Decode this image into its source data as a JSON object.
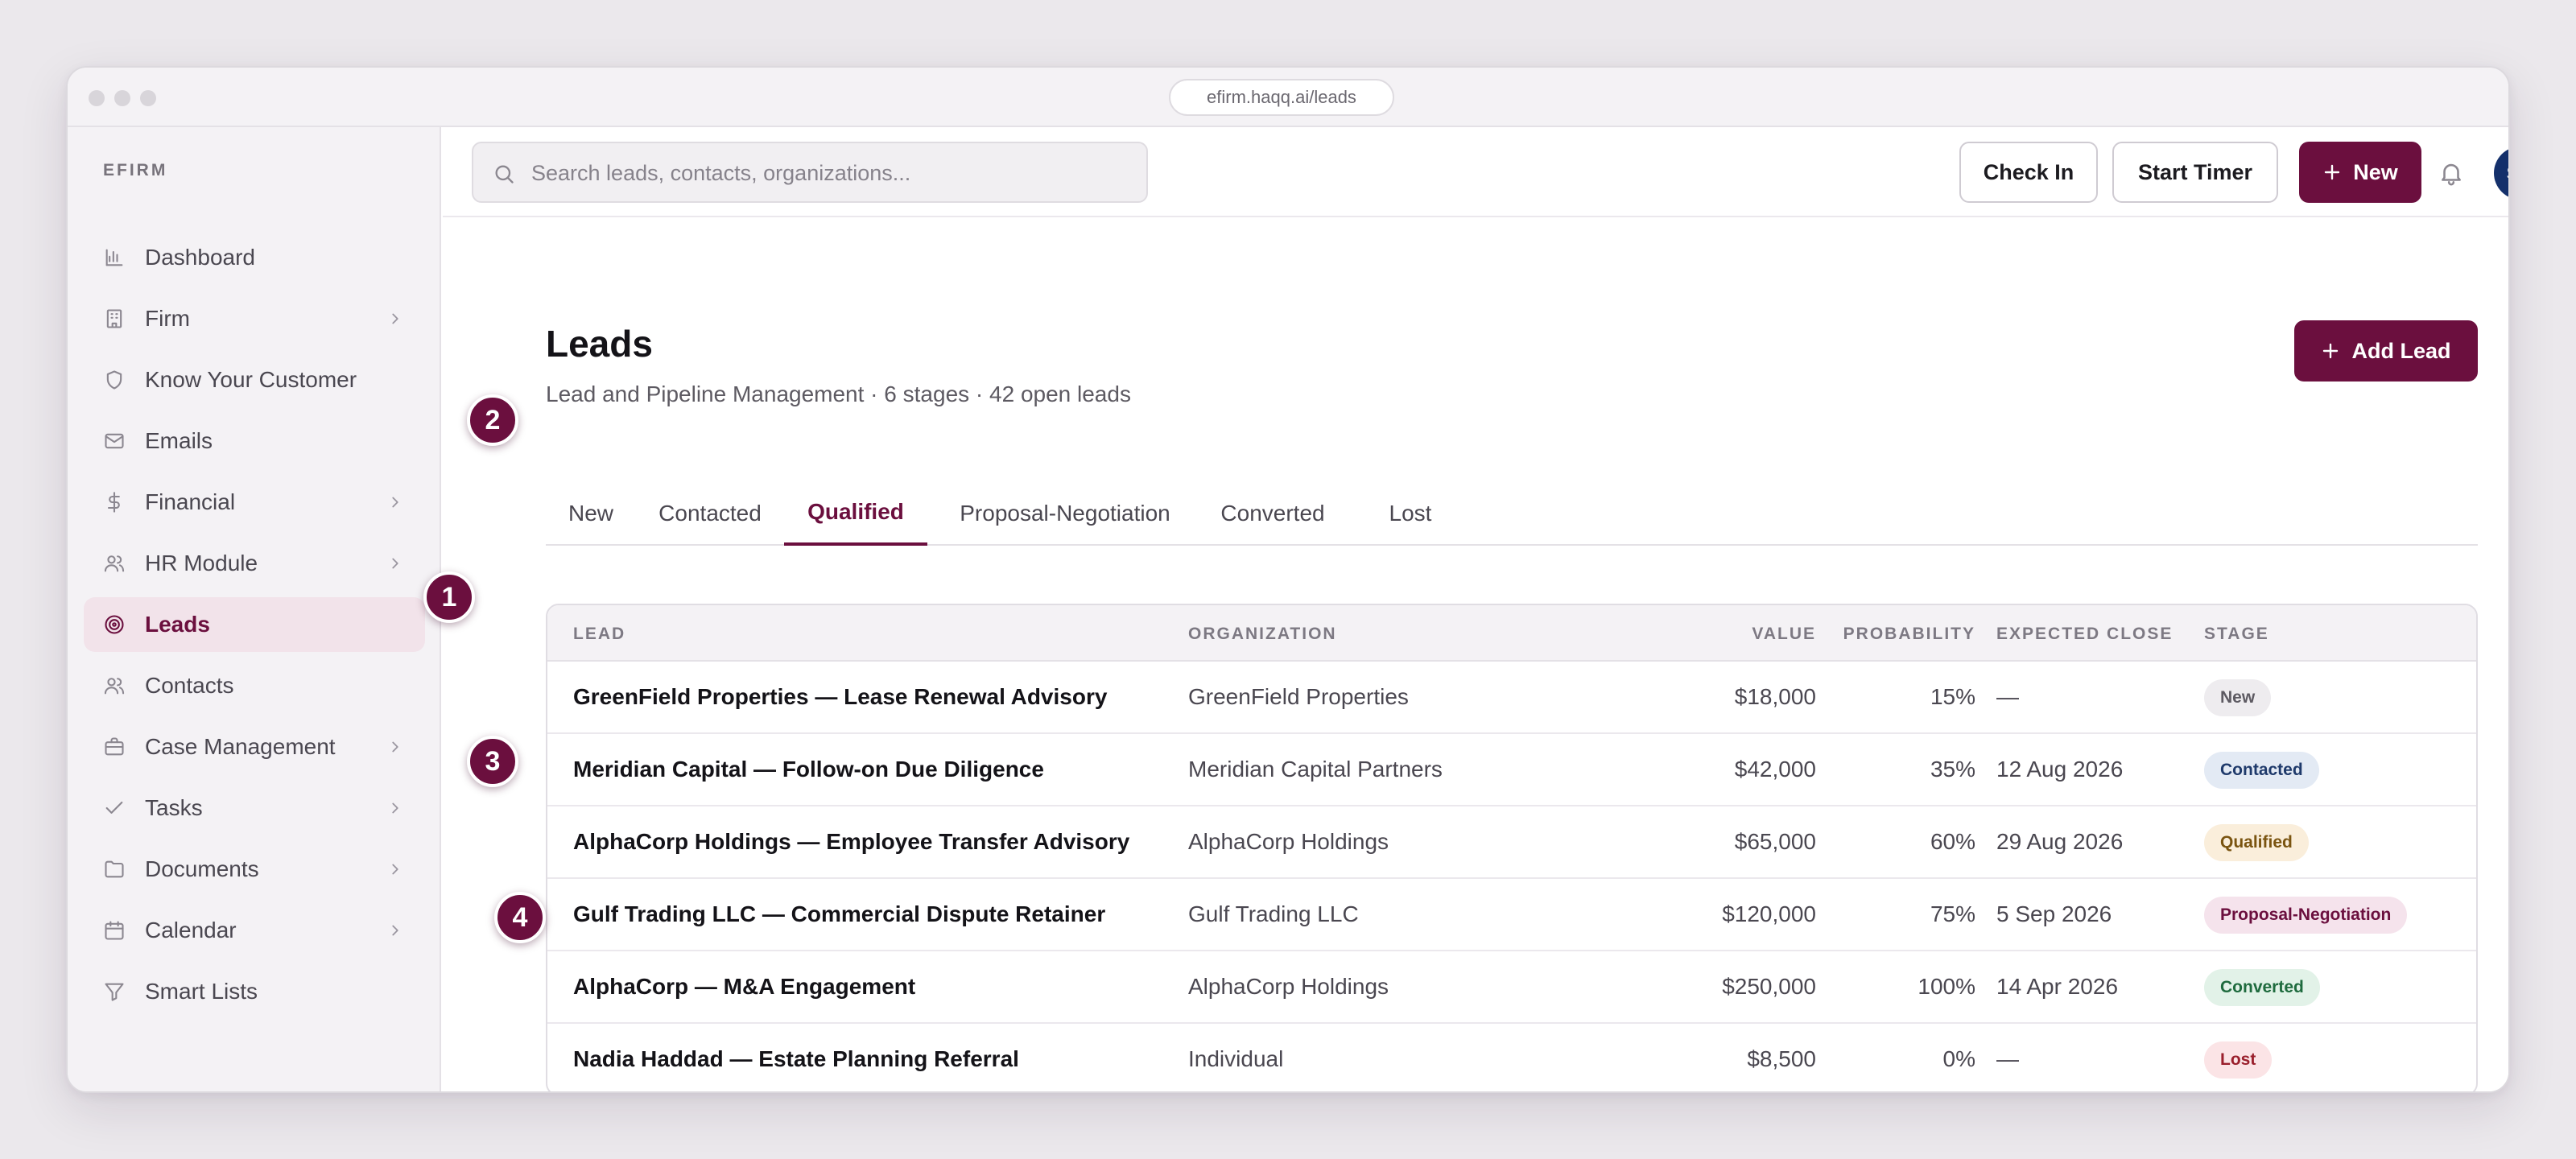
{
  "browser": {
    "url": "efirm.haqq.ai/leads"
  },
  "sidebar": {
    "brand": "EFIRM",
    "items": [
      {
        "label": "Dashboard",
        "icon": "chart-icon",
        "chevron": false,
        "active": false
      },
      {
        "label": "Firm",
        "icon": "building-icon",
        "chevron": true,
        "active": false
      },
      {
        "label": "Know Your Customer",
        "icon": "shield-icon",
        "chevron": false,
        "active": false
      },
      {
        "label": "Emails",
        "icon": "mail-icon",
        "chevron": false,
        "active": false
      },
      {
        "label": "Financial",
        "icon": "dollar-icon",
        "chevron": true,
        "active": false
      },
      {
        "label": "HR Module",
        "icon": "users-icon",
        "chevron": true,
        "active": false
      },
      {
        "label": "Leads",
        "icon": "target-icon",
        "chevron": false,
        "active": true
      },
      {
        "label": "Contacts",
        "icon": "contacts-icon",
        "chevron": false,
        "active": false
      },
      {
        "label": "Case Management",
        "icon": "briefcase-icon",
        "chevron": true,
        "active": false
      },
      {
        "label": "Tasks",
        "icon": "check-icon",
        "chevron": true,
        "active": false
      },
      {
        "label": "Documents",
        "icon": "folder-icon",
        "chevron": true,
        "active": false
      },
      {
        "label": "Calendar",
        "icon": "calendar-icon",
        "chevron": true,
        "active": false
      },
      {
        "label": "Smart Lists",
        "icon": "filter-icon",
        "chevron": false,
        "active": false
      }
    ]
  },
  "topbar": {
    "search_placeholder": "Search leads, contacts, organizations...",
    "check_in_label": "Check In",
    "start_timer_label": "Start Timer",
    "new_label": "New",
    "avatar_initials": "SM"
  },
  "page": {
    "title": "Leads",
    "subtitle": "Lead and Pipeline Management · 6 stages · 42 open leads",
    "add_lead_label": "Add Lead"
  },
  "tabs": [
    {
      "label": "New",
      "active": false
    },
    {
      "label": "Contacted",
      "active": false
    },
    {
      "label": "Qualified",
      "active": true
    },
    {
      "label": "Proposal-Negotiation",
      "active": false
    },
    {
      "label": "Converted",
      "active": false
    },
    {
      "label": "Lost",
      "active": false
    }
  ],
  "table": {
    "columns": [
      "LEAD",
      "ORGANIZATION",
      "VALUE",
      "PROBABILITY",
      "EXPECTED CLOSE",
      "STAGE"
    ],
    "rows": [
      {
        "lead": "GreenField Properties — Lease Renewal Advisory",
        "organization": "GreenField Properties",
        "value": "$18,000",
        "probability": "15%",
        "expected_close": "—",
        "stage": "New"
      },
      {
        "lead": "Meridian Capital — Follow-on Due Diligence",
        "organization": "Meridian Capital Partners",
        "value": "$42,000",
        "probability": "35%",
        "expected_close": "12 Aug 2026",
        "stage": "Contacted"
      },
      {
        "lead": "AlphaCorp Holdings — Employee Transfer Advisory",
        "organization": "AlphaCorp Holdings",
        "value": "$65,000",
        "probability": "60%",
        "expected_close": "29 Aug 2026",
        "stage": "Qualified"
      },
      {
        "lead": "Gulf Trading LLC — Commercial Dispute Retainer",
        "organization": "Gulf Trading LLC",
        "value": "$120,000",
        "probability": "75%",
        "expected_close": "5 Sep 2026",
        "stage": "Proposal-Negotiation"
      },
      {
        "lead": "AlphaCorp — M&A Engagement",
        "organization": "AlphaCorp Holdings",
        "value": "$250,000",
        "probability": "100%",
        "expected_close": "14 Apr 2026",
        "stage": "Converted"
      },
      {
        "lead": "Nadia Haddad — Estate Planning Referral",
        "organization": "Individual",
        "value": "$8,500",
        "probability": "0%",
        "expected_close": "—",
        "stage": "Lost"
      }
    ]
  },
  "stage_colors": {
    "New": {
      "bg": "#eeecef",
      "fg": "#5d5a62"
    },
    "Contacted": {
      "bg": "#e3eaf4",
      "fg": "#1f3a6b"
    },
    "Qualified": {
      "bg": "#faeedb",
      "fg": "#7a5410"
    },
    "Proposal-Negotiation": {
      "bg": "#f5e3ec",
      "fg": "#6b0f3e"
    },
    "Converted": {
      "bg": "#e2f2e8",
      "fg": "#1f6b3e"
    },
    "Lost": {
      "bg": "#fbe4e6",
      "fg": "#9a1f2c"
    }
  },
  "markers": [
    "1",
    "2",
    "3",
    "4"
  ],
  "colors": {
    "accent": "#6b0f3e",
    "avatar": "#14306b"
  }
}
